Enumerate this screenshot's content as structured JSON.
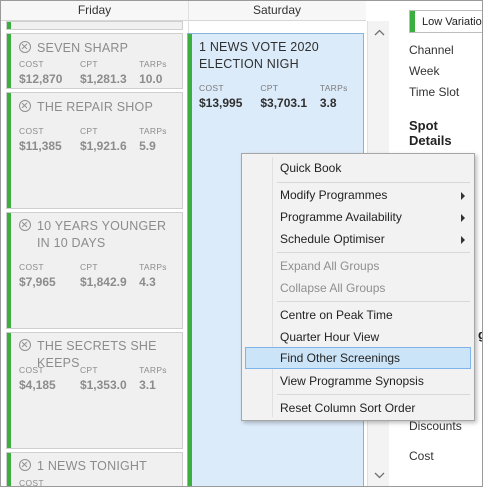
{
  "columns": {
    "friday": "Friday",
    "saturday": "Saturday"
  },
  "friday_cards": [
    {
      "title": "SEVEN SHARP",
      "cost_label": "COST",
      "cost": "$12,870",
      "cpt_label": "CPT",
      "cpt": "$1,281.3",
      "tarps_label": "TARPs",
      "tarps": "10.0"
    },
    {
      "title": "THE REPAIR SHOP",
      "cost_label": "COST",
      "cost": "$11,385",
      "cpt_label": "CPT",
      "cpt": "$1,921.6",
      "tarps_label": "TARPs",
      "tarps": "5.9"
    },
    {
      "title": "10 YEARS YOUNGER IN 10 DAYS",
      "cost_label": "COST",
      "cost": "$7,965",
      "cpt_label": "CPT",
      "cpt": "$1,842.9",
      "tarps_label": "TARPs",
      "tarps": "4.3"
    },
    {
      "title": "THE SECRETS SHE KEEPS",
      "cost_label": "COST",
      "cost": "$4,185",
      "cpt_label": "CPT",
      "cpt": "$1,353.0",
      "tarps_label": "TARPs",
      "tarps": "3.1"
    },
    {
      "title": "1 NEWS TONIGHT",
      "cost_label": "COST"
    }
  ],
  "saturday_card": {
    "title": "1 NEWS VOTE 2020 ELECTION NIGH",
    "cost_label": "COST",
    "cost": "$13,995",
    "cpt_label": "CPT",
    "cpt": "$3,703.1",
    "tarps_label": "TARPs",
    "tarps": "3.8"
  },
  "right_panel": {
    "variation": "Low Variation",
    "labels": [
      "Channel",
      "Week",
      "Time Slot"
    ],
    "section_title": "Spot Details",
    "partial_glyph": "g",
    "bottom_labels": [
      "Discounts",
      "Cost"
    ]
  },
  "context_menu": {
    "items": [
      {
        "label": "Quick Book"
      },
      {
        "label": "Modify Programmes"
      },
      {
        "label": "Programme Availability"
      },
      {
        "label": "Schedule Optimiser"
      },
      {
        "label": "Expand All Groups"
      },
      {
        "label": "Collapse All Groups"
      },
      {
        "label": "Centre on Peak Time"
      },
      {
        "label": "Quarter Hour View"
      },
      {
        "label": "Find Other Screenings"
      },
      {
        "label": "View Programme Synopsis"
      },
      {
        "label": "Reset Column Sort Order"
      }
    ]
  },
  "colors": {
    "accent_green": "#3cae3f",
    "selected_card": "#dcebfa",
    "menu_highlight": "#cce4f7"
  }
}
